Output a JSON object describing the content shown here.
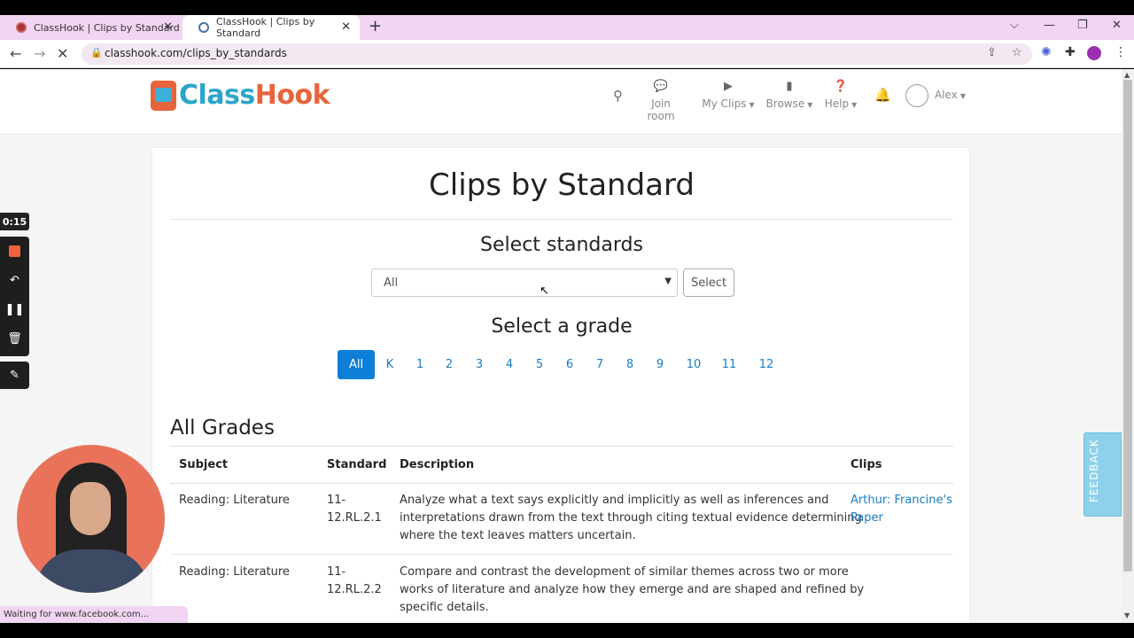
{
  "browser": {
    "tabs": [
      {
        "title": "ClassHook | Clips by Standard"
      },
      {
        "title": "ClassHook | Clips by Standard"
      }
    ],
    "url": "classhook.com/clips_by_standards",
    "status": "Waiting for www.facebook.com..."
  },
  "site": {
    "logo": {
      "part1": "Class",
      "part2": "Hook"
    },
    "nav": {
      "join_room": "Join room",
      "my_clips": "My Clips",
      "browse": "Browse",
      "help": "Help",
      "user": "Alex"
    },
    "feedback": "FEEDBACK"
  },
  "main": {
    "title": "Clips by Standard",
    "select_standards_heading": "Select standards",
    "standards_select_value": "All",
    "select_button": "Select",
    "select_grade_heading": "Select a grade",
    "grades": [
      "All",
      "K",
      "1",
      "2",
      "3",
      "4",
      "5",
      "6",
      "7",
      "8",
      "9",
      "10",
      "11",
      "12"
    ],
    "active_grade": "All",
    "section_heading": "All Grades",
    "table": {
      "headers": [
        "Subject",
        "Standard",
        "Description",
        "Clips"
      ],
      "rows": [
        {
          "subject": "Reading: Literature",
          "standard_l1": "11-",
          "standard_l2": "12.RL.2.1",
          "desc_l1": "Analyze what a text says explicitly and implicitly as well as inferences and",
          "desc_l2": "interpretations drawn from the text through citing textual evidence determining",
          "desc_l3": "where the text leaves matters uncertain.",
          "clip_l1": "Arthur: Francine's",
          "clip_l2": "Paper"
        },
        {
          "subject": "Reading: Literature",
          "standard_l1": "11-",
          "standard_l2": "12.RL.2.2",
          "desc_l1": "Compare and contrast the development of similar themes across two or more",
          "desc_l2": "works of literature and analyze how they emerge and are shaped and refined by",
          "desc_l3": "specific details.",
          "clip_l1": "",
          "clip_l2": ""
        }
      ]
    }
  },
  "recorder": {
    "time": "0:15"
  },
  "colors": {
    "accent": "#0d7fd8",
    "link": "#1a7dc2",
    "logo_blue": "#2ba6cb",
    "logo_orange": "#e8643c"
  }
}
